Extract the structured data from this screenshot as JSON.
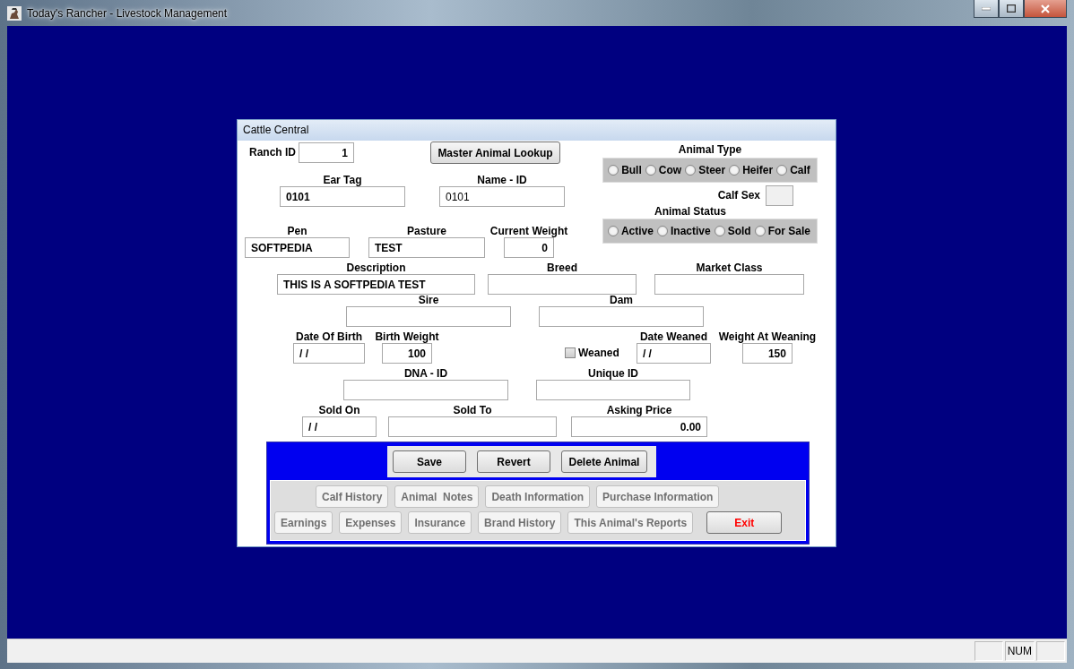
{
  "window": {
    "title": "Today's Rancher - Livestock Management"
  },
  "dialog": {
    "title": "Cattle Central"
  },
  "master_lookup": {
    "label": "Master Animal Lookup"
  },
  "fields": [
    {
      "label": "Ranch ID",
      "value": "1"
    },
    {
      "label": "Ear Tag",
      "value": "0101"
    },
    {
      "label": "Name - ID",
      "value": "0101"
    },
    {
      "label": "Calf Sex"
    },
    {
      "label": "Pen",
      "value": "SOFTPEDIA"
    },
    {
      "label": "Pasture",
      "value": "TEST"
    },
    {
      "label": "Current Weight",
      "value": "0"
    },
    {
      "label": "Description",
      "value": "THIS IS A SOFTPEDIA TEST"
    },
    {
      "label": "Breed"
    },
    {
      "label": "Market Class"
    },
    {
      "label": "Sire"
    },
    {
      "label": "Dam"
    },
    {
      "label": "Date Of Birth",
      "value": "/ /"
    },
    {
      "label": "Birth Weight",
      "value": "100"
    },
    {
      "label": "Date Weaned",
      "value": "/ /"
    },
    {
      "label": "Weight At Weaning",
      "value": "150"
    },
    {
      "label": "DNA - ID"
    },
    {
      "label": "Unique ID"
    },
    {
      "label": "Sold On",
      "value": "/ /"
    },
    {
      "label": "Sold To"
    },
    {
      "label": "Asking Price",
      "value": "0.00"
    }
  ],
  "animal_type": {
    "label": "Animal Type",
    "options": [
      {
        "label": "Bull",
        "selected": false
      },
      {
        "label": "Cow",
        "selected": false
      },
      {
        "label": "Steer",
        "selected": false
      },
      {
        "label": "Heifer",
        "selected": false
      },
      {
        "label": "Calf",
        "selected": false
      }
    ]
  },
  "animal_status": {
    "label": "Animal Status",
    "options": [
      {
        "label": "Active",
        "selected": false
      },
      {
        "label": "Inactive",
        "selected": false
      },
      {
        "label": "Sold",
        "selected": false
      },
      {
        "label": "For Sale",
        "selected": false
      }
    ]
  },
  "weaned": {
    "label": "Weaned",
    "checked": false
  },
  "actions": [
    "Save",
    "Revert",
    "Delete Animal"
  ],
  "nav_rows": [
    [
      {
        "label": "Calf History",
        "disabled": true
      },
      {
        "label": "Animal  Notes",
        "disabled": true
      },
      {
        "label": "Death Information",
        "disabled": true
      },
      {
        "label": "Purchase Information",
        "disabled": true
      }
    ],
    [
      {
        "label": "Earnings",
        "disabled": true
      },
      {
        "label": "Expenses",
        "disabled": true
      },
      {
        "label": "Insurance",
        "disabled": true
      },
      {
        "label": "Brand History",
        "disabled": true
      },
      {
        "label": "This Animal's Reports",
        "disabled": true
      }
    ]
  ],
  "exit_button": {
    "label": "Exit"
  },
  "status_bar": {
    "indicator": "NUM"
  }
}
